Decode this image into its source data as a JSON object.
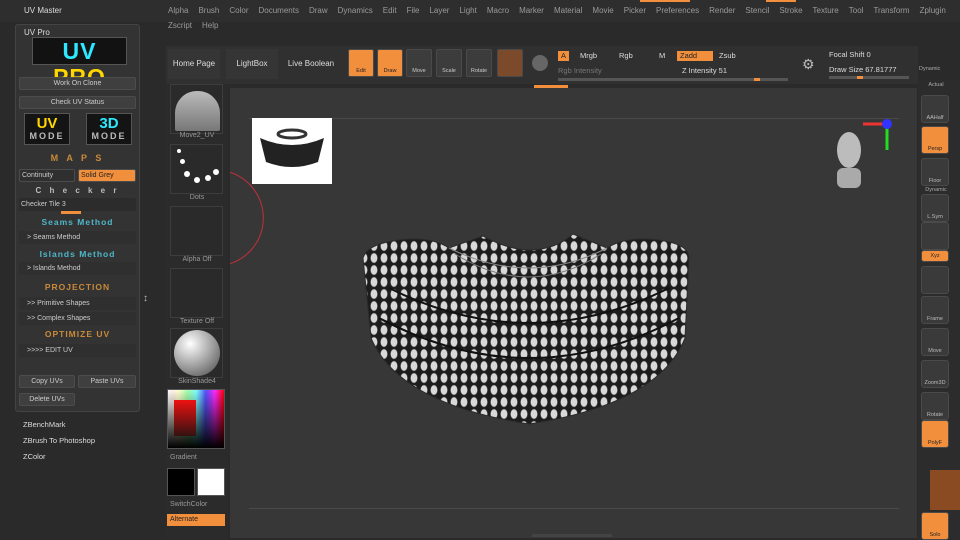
{
  "menubar": {
    "title": "UV Master",
    "items": [
      "Alpha",
      "Brush",
      "Color",
      "Documents",
      "Draw",
      "Dynamics",
      "Edit",
      "File",
      "Layer",
      "Light",
      "Macro",
      "Marker",
      "Material",
      "Movie",
      "Picker",
      "Preferences",
      "Render",
      "Stencil",
      "Stroke",
      "Texture",
      "Tool",
      "Transform",
      "Zplugin"
    ],
    "items2": [
      "Zscript",
      "Help"
    ]
  },
  "left_panel": {
    "header": "UV Pro",
    "logo_a": "UV ",
    "logo_b": "PRO",
    "work_on_clone": "Work On Clone",
    "check_uv_status": "Check UV Status",
    "uv_mode_big": "UV",
    "uv_mode_small": "MODE",
    "mode3d_big": "3D",
    "mode3d_small": "MODE",
    "maps": "M A P S",
    "continuity": "Continuity",
    "solid_grey": "Solid Grey",
    "checker": "C h e c k e r",
    "checker_tile": "Checker Tile 3",
    "seams_title": "Seams Method",
    "seams_item": "> Seams Method",
    "islands_title": "Islands Method",
    "islands_item": "> Islands Method",
    "projection": "PROJECTION",
    "primitive": ">> Primitive Shapes",
    "complex": ">> Complex Shapes",
    "optimize": "OPTIMIZE UV",
    "edit_uv": ">>>> EDIT UV",
    "copy_uvs": "Copy UVs",
    "paste_uvs": "Paste UVs",
    "delete_uvs": "Delete UVs"
  },
  "plugins": [
    "ZBenchMark",
    "ZBrush To Photoshop",
    "ZColor"
  ],
  "shelf": {
    "home": "Home Page",
    "lightbox": "LightBox",
    "live_boolean": "Live Boolean",
    "edit": "Edit",
    "draw": "Draw",
    "move": "Move",
    "scale": "Scale",
    "rotate": "Rotate",
    "a": "A",
    "mrgb": "Mrgb",
    "rgb": "Rgb",
    "m": "M",
    "zadd": "Zadd",
    "zsub": "Zsub",
    "rgb_intensity": "Rgb Intensity",
    "z_intensity": "Z Intensity 51",
    "focal_shift": "Focal Shift 0",
    "draw_size": "Draw Size 67.81777",
    "dynamic": "Dynamic"
  },
  "brushtray": {
    "t1": "Move2_UV",
    "t2": "Dots",
    "t3": "Alpha Off",
    "t4": "Texture Off",
    "t5": "SkinShade4",
    "gradient": "Gradient",
    "switch": "SwitchColor",
    "alternate": "Alternate"
  },
  "right": {
    "actual": "Actual",
    "aahalf": "AAHalf",
    "persp": "Persp",
    "floor": "Floor",
    "dynamic": "Dynamic",
    "lsym": "L.Sym",
    "xyz": "Xyz",
    "frame": "Frame",
    "move": "Move",
    "zoom3d": "Zoom3D",
    "rotate": "Rotate",
    "polyf": "PolyF",
    "solo": "Solo"
  },
  "colors": {
    "accent": "#f28f3d",
    "cyan": "#2de8ff",
    "yellow": "#ffd600",
    "teal": "#4fb7c9"
  }
}
